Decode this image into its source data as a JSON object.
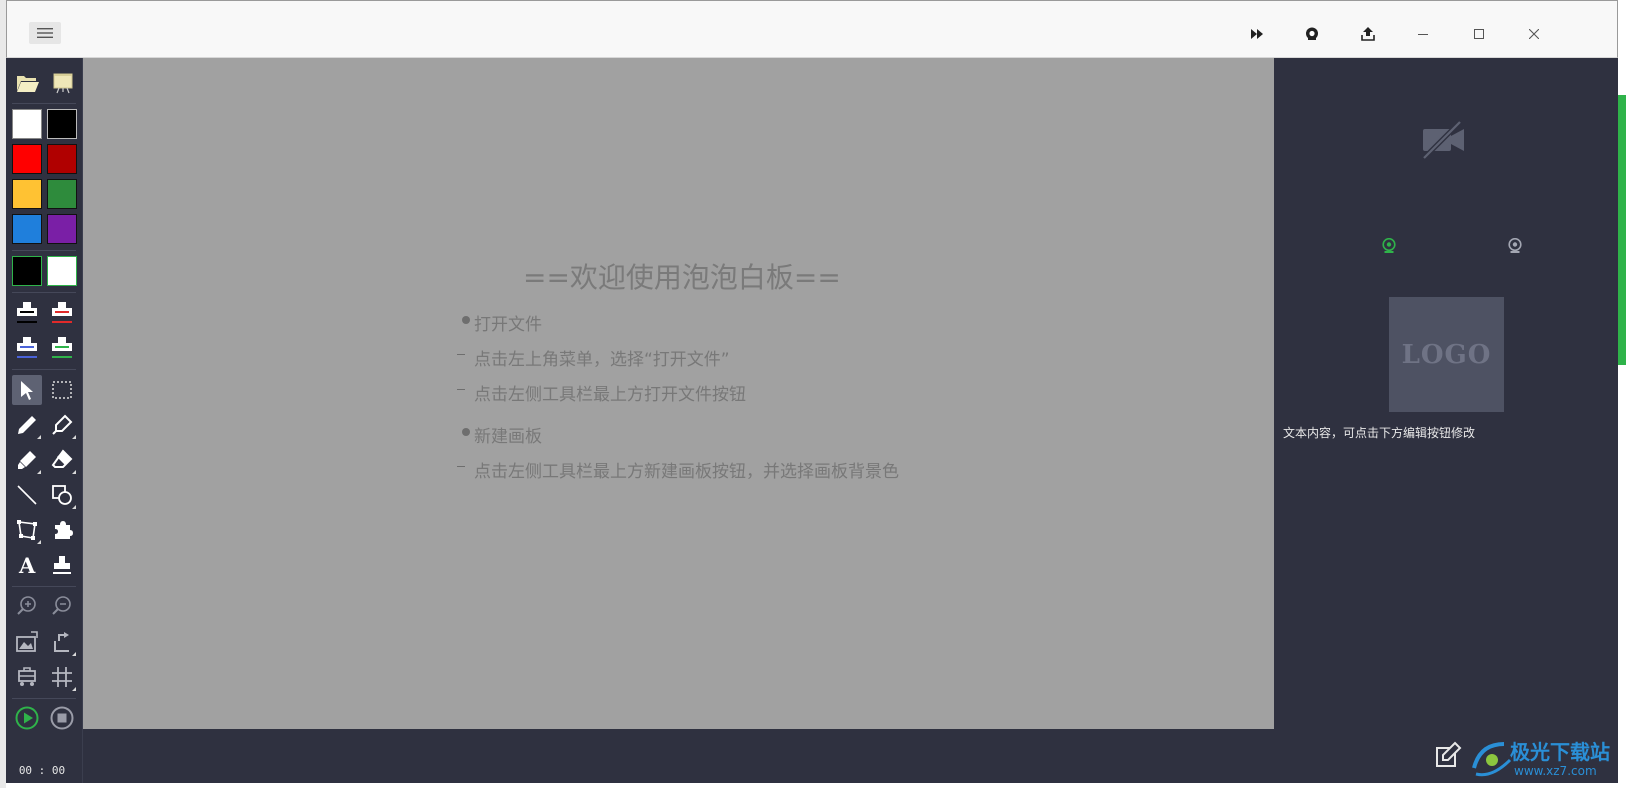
{
  "titlebar": {
    "menu_icon": "hamburger-icon",
    "actions": [
      "fast-forward-icon",
      "record-icon",
      "share-upload-icon"
    ],
    "window_controls": [
      "minimize-icon",
      "maximize-icon",
      "close-icon"
    ]
  },
  "toolbar": {
    "colors": [
      "#ffffff",
      "#000000",
      "#ff0000",
      "#b00000",
      "#ffc233",
      "#2e8b3c",
      "#1f7fdc",
      "#7a1fa6"
    ],
    "background_swatches": [
      "#000000",
      "#ffffff"
    ],
    "timer": "00 : 00"
  },
  "whiteboard": {
    "title": "==欢迎使用泡泡白板==",
    "section1": "打开文件",
    "section1_items": [
      "点击左上角菜单，选择“打开文件”",
      "点击左侧工具栏最上方打开文件按钮"
    ],
    "section2": "新建画板",
    "section2_items": [
      "点击左侧工具栏最上方新建画板按钮，并选择画板背景色"
    ]
  },
  "right_panel": {
    "logo_text": "LOGO",
    "info_text": "文本内容，可点击下方编辑按钮修改",
    "camera_icons": [
      "camera-off-icon",
      "webcam-active-icon",
      "webcam-icon"
    ],
    "edit_icon": "edit-icon"
  },
  "watermark": {
    "cn": "极光下载站",
    "en": "www.xz7.com"
  },
  "colors": {
    "panel_bg": "#2f3140",
    "canvas_bg": "#a1a1a1",
    "accent_green": "#2fb34a"
  }
}
